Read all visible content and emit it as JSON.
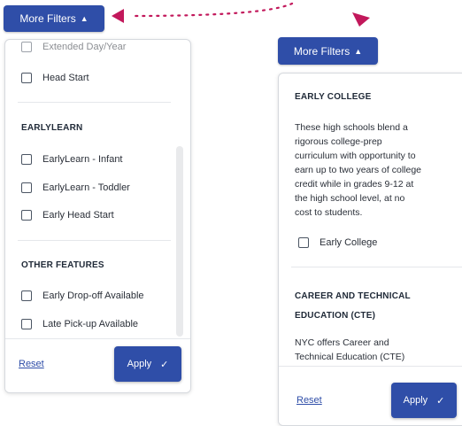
{
  "more_filters_label": "More Filters",
  "left_panel": {
    "partial_top": "Extended Day/Year",
    "options_top": [
      "Head Start"
    ],
    "sections": [
      {
        "title": "EARLYLEARN",
        "options": [
          "EarlyLearn - Infant",
          "EarlyLearn - Toddler",
          "Early Head Start"
        ]
      },
      {
        "title": "OTHER FEATURES",
        "options": [
          "Early Drop-off Available",
          "Late Pick-up Available"
        ]
      }
    ]
  },
  "right_panel": {
    "section_title": "EARLY COLLEGE",
    "description_lines": [
      "These high schools blend a",
      "rigorous college-prep",
      "curriculum with opportunity to",
      "earn up to two years of college",
      "credit while in grades 9-12 at",
      "the high school level, at no",
      "cost to students."
    ],
    "option": "Early College",
    "section2_title_lines": [
      "CAREER AND TECHNICAL",
      "EDUCATION (CTE)"
    ],
    "description2_lines": [
      "NYC offers Career and",
      "Technical Education (CTE)"
    ]
  },
  "footer": {
    "reset_label": "Reset",
    "apply_label": "Apply"
  },
  "colors": {
    "primary": "#2f4ea8",
    "arrow": "#c2185b"
  },
  "icons": {
    "chevron": "chevron-up-icon",
    "check": "check-icon",
    "arrow": "dotted-arrow-icon"
  }
}
